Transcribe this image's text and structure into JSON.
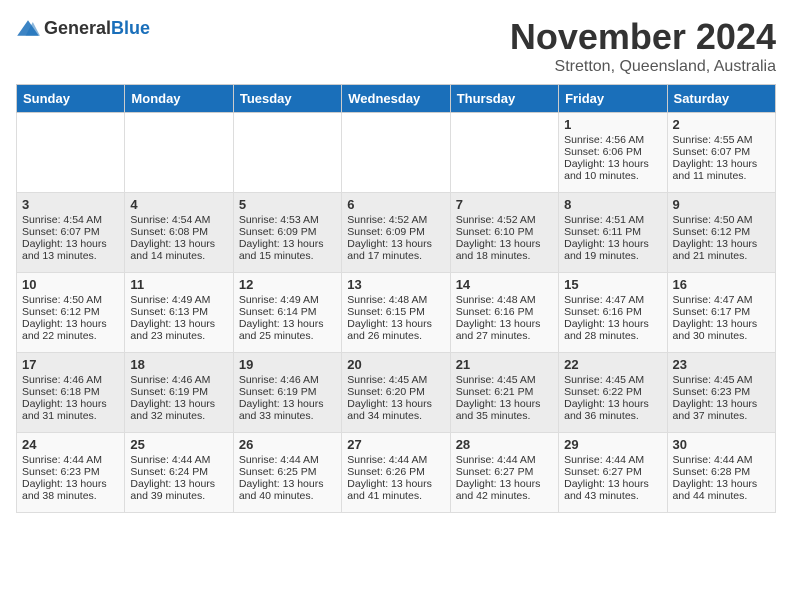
{
  "logo": {
    "general": "General",
    "blue": "Blue"
  },
  "title": "November 2024",
  "subtitle": "Stretton, Queensland, Australia",
  "days_of_week": [
    "Sunday",
    "Monday",
    "Tuesday",
    "Wednesday",
    "Thursday",
    "Friday",
    "Saturday"
  ],
  "weeks": [
    [
      {
        "day": "",
        "sunrise": "",
        "sunset": "",
        "daylight": ""
      },
      {
        "day": "",
        "sunrise": "",
        "sunset": "",
        "daylight": ""
      },
      {
        "day": "",
        "sunrise": "",
        "sunset": "",
        "daylight": ""
      },
      {
        "day": "",
        "sunrise": "",
        "sunset": "",
        "daylight": ""
      },
      {
        "day": "",
        "sunrise": "",
        "sunset": "",
        "daylight": ""
      },
      {
        "day": "1",
        "sunrise": "Sunrise: 4:56 AM",
        "sunset": "Sunset: 6:06 PM",
        "daylight": "Daylight: 13 hours and 10 minutes."
      },
      {
        "day": "2",
        "sunrise": "Sunrise: 4:55 AM",
        "sunset": "Sunset: 6:07 PM",
        "daylight": "Daylight: 13 hours and 11 minutes."
      }
    ],
    [
      {
        "day": "3",
        "sunrise": "Sunrise: 4:54 AM",
        "sunset": "Sunset: 6:07 PM",
        "daylight": "Daylight: 13 hours and 13 minutes."
      },
      {
        "day": "4",
        "sunrise": "Sunrise: 4:54 AM",
        "sunset": "Sunset: 6:08 PM",
        "daylight": "Daylight: 13 hours and 14 minutes."
      },
      {
        "day": "5",
        "sunrise": "Sunrise: 4:53 AM",
        "sunset": "Sunset: 6:09 PM",
        "daylight": "Daylight: 13 hours and 15 minutes."
      },
      {
        "day": "6",
        "sunrise": "Sunrise: 4:52 AM",
        "sunset": "Sunset: 6:09 PM",
        "daylight": "Daylight: 13 hours and 17 minutes."
      },
      {
        "day": "7",
        "sunrise": "Sunrise: 4:52 AM",
        "sunset": "Sunset: 6:10 PM",
        "daylight": "Daylight: 13 hours and 18 minutes."
      },
      {
        "day": "8",
        "sunrise": "Sunrise: 4:51 AM",
        "sunset": "Sunset: 6:11 PM",
        "daylight": "Daylight: 13 hours and 19 minutes."
      },
      {
        "day": "9",
        "sunrise": "Sunrise: 4:50 AM",
        "sunset": "Sunset: 6:12 PM",
        "daylight": "Daylight: 13 hours and 21 minutes."
      }
    ],
    [
      {
        "day": "10",
        "sunrise": "Sunrise: 4:50 AM",
        "sunset": "Sunset: 6:12 PM",
        "daylight": "Daylight: 13 hours and 22 minutes."
      },
      {
        "day": "11",
        "sunrise": "Sunrise: 4:49 AM",
        "sunset": "Sunset: 6:13 PM",
        "daylight": "Daylight: 13 hours and 23 minutes."
      },
      {
        "day": "12",
        "sunrise": "Sunrise: 4:49 AM",
        "sunset": "Sunset: 6:14 PM",
        "daylight": "Daylight: 13 hours and 25 minutes."
      },
      {
        "day": "13",
        "sunrise": "Sunrise: 4:48 AM",
        "sunset": "Sunset: 6:15 PM",
        "daylight": "Daylight: 13 hours and 26 minutes."
      },
      {
        "day": "14",
        "sunrise": "Sunrise: 4:48 AM",
        "sunset": "Sunset: 6:16 PM",
        "daylight": "Daylight: 13 hours and 27 minutes."
      },
      {
        "day": "15",
        "sunrise": "Sunrise: 4:47 AM",
        "sunset": "Sunset: 6:16 PM",
        "daylight": "Daylight: 13 hours and 28 minutes."
      },
      {
        "day": "16",
        "sunrise": "Sunrise: 4:47 AM",
        "sunset": "Sunset: 6:17 PM",
        "daylight": "Daylight: 13 hours and 30 minutes."
      }
    ],
    [
      {
        "day": "17",
        "sunrise": "Sunrise: 4:46 AM",
        "sunset": "Sunset: 6:18 PM",
        "daylight": "Daylight: 13 hours and 31 minutes."
      },
      {
        "day": "18",
        "sunrise": "Sunrise: 4:46 AM",
        "sunset": "Sunset: 6:19 PM",
        "daylight": "Daylight: 13 hours and 32 minutes."
      },
      {
        "day": "19",
        "sunrise": "Sunrise: 4:46 AM",
        "sunset": "Sunset: 6:19 PM",
        "daylight": "Daylight: 13 hours and 33 minutes."
      },
      {
        "day": "20",
        "sunrise": "Sunrise: 4:45 AM",
        "sunset": "Sunset: 6:20 PM",
        "daylight": "Daylight: 13 hours and 34 minutes."
      },
      {
        "day": "21",
        "sunrise": "Sunrise: 4:45 AM",
        "sunset": "Sunset: 6:21 PM",
        "daylight": "Daylight: 13 hours and 35 minutes."
      },
      {
        "day": "22",
        "sunrise": "Sunrise: 4:45 AM",
        "sunset": "Sunset: 6:22 PM",
        "daylight": "Daylight: 13 hours and 36 minutes."
      },
      {
        "day": "23",
        "sunrise": "Sunrise: 4:45 AM",
        "sunset": "Sunset: 6:23 PM",
        "daylight": "Daylight: 13 hours and 37 minutes."
      }
    ],
    [
      {
        "day": "24",
        "sunrise": "Sunrise: 4:44 AM",
        "sunset": "Sunset: 6:23 PM",
        "daylight": "Daylight: 13 hours and 38 minutes."
      },
      {
        "day": "25",
        "sunrise": "Sunrise: 4:44 AM",
        "sunset": "Sunset: 6:24 PM",
        "daylight": "Daylight: 13 hours and 39 minutes."
      },
      {
        "day": "26",
        "sunrise": "Sunrise: 4:44 AM",
        "sunset": "Sunset: 6:25 PM",
        "daylight": "Daylight: 13 hours and 40 minutes."
      },
      {
        "day": "27",
        "sunrise": "Sunrise: 4:44 AM",
        "sunset": "Sunset: 6:26 PM",
        "daylight": "Daylight: 13 hours and 41 minutes."
      },
      {
        "day": "28",
        "sunrise": "Sunrise: 4:44 AM",
        "sunset": "Sunset: 6:27 PM",
        "daylight": "Daylight: 13 hours and 42 minutes."
      },
      {
        "day": "29",
        "sunrise": "Sunrise: 4:44 AM",
        "sunset": "Sunset: 6:27 PM",
        "daylight": "Daylight: 13 hours and 43 minutes."
      },
      {
        "day": "30",
        "sunrise": "Sunrise: 4:44 AM",
        "sunset": "Sunset: 6:28 PM",
        "daylight": "Daylight: 13 hours and 44 minutes."
      }
    ]
  ]
}
